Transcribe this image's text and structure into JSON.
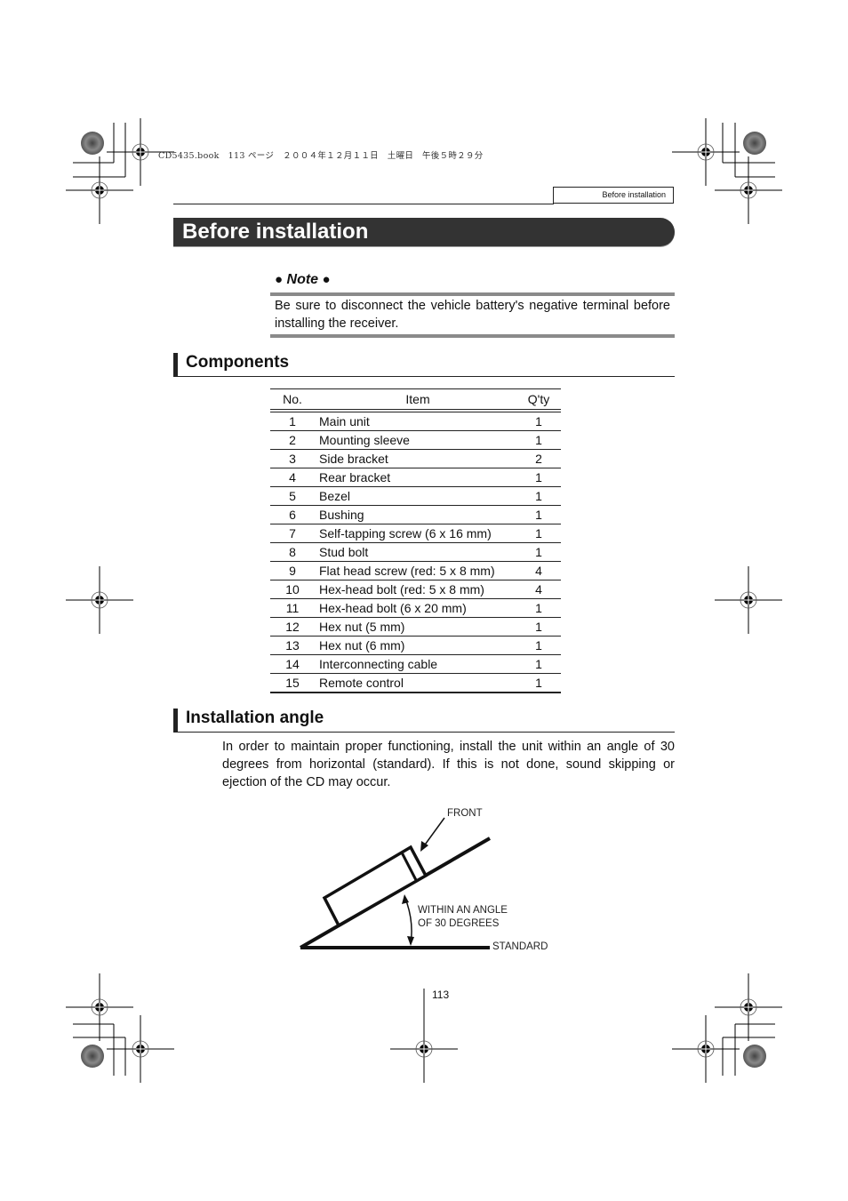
{
  "print_header": {
    "file": "CD5435.book",
    "page_ref": "113 ページ",
    "date": "２００４年１２月１１日　土曜日　午後５時２９分"
  },
  "running_header": "Before installation",
  "page_title": "Before installation",
  "note": {
    "heading": "Note",
    "bullet": "●",
    "text": "Be sure to disconnect the vehicle battery's negative terminal before installing the receiver."
  },
  "components": {
    "heading": "Components",
    "columns": [
      "No.",
      "Item",
      "Q'ty"
    ],
    "rows": [
      {
        "no": "1",
        "item": "Main unit",
        "qty": "1"
      },
      {
        "no": "2",
        "item": "Mounting sleeve",
        "qty": "1"
      },
      {
        "no": "3",
        "item": "Side bracket",
        "qty": "2"
      },
      {
        "no": "4",
        "item": "Rear bracket",
        "qty": "1"
      },
      {
        "no": "5",
        "item": "Bezel",
        "qty": "1"
      },
      {
        "no": "6",
        "item": "Bushing",
        "qty": "1"
      },
      {
        "no": "7",
        "item": "Self-tapping screw (6 x 16 mm)",
        "qty": "1"
      },
      {
        "no": "8",
        "item": "Stud bolt",
        "qty": "1"
      },
      {
        "no": "9",
        "item": "Flat head screw (red: 5 x 8 mm)",
        "qty": "4"
      },
      {
        "no": "10",
        "item": "Hex-head bolt (red: 5 x 8 mm)",
        "qty": "4"
      },
      {
        "no": "11",
        "item": "Hex-head bolt (6 x 20 mm)",
        "qty": "1"
      },
      {
        "no": "12",
        "item": "Hex nut (5 mm)",
        "qty": "1"
      },
      {
        "no": "13",
        "item": "Hex nut (6 mm)",
        "qty": "1"
      },
      {
        "no": "14",
        "item": "Interconnecting cable",
        "qty": "1"
      },
      {
        "no": "15",
        "item": "Remote control",
        "qty": "1"
      }
    ]
  },
  "installation_angle": {
    "heading": "Installation angle",
    "text": "In order to maintain proper functioning, install the unit within an angle of 30 degrees from horizontal (standard). If this is not done, sound skipping or ejection of the CD may occur.",
    "diagram": {
      "label_front": "FRONT",
      "label_angle_line1": "WITHIN AN ANGLE",
      "label_angle_line2": "OF 30 DEGREES",
      "label_standard": "STANDARD",
      "max_angle_degrees": 30
    }
  },
  "page_number": "113"
}
